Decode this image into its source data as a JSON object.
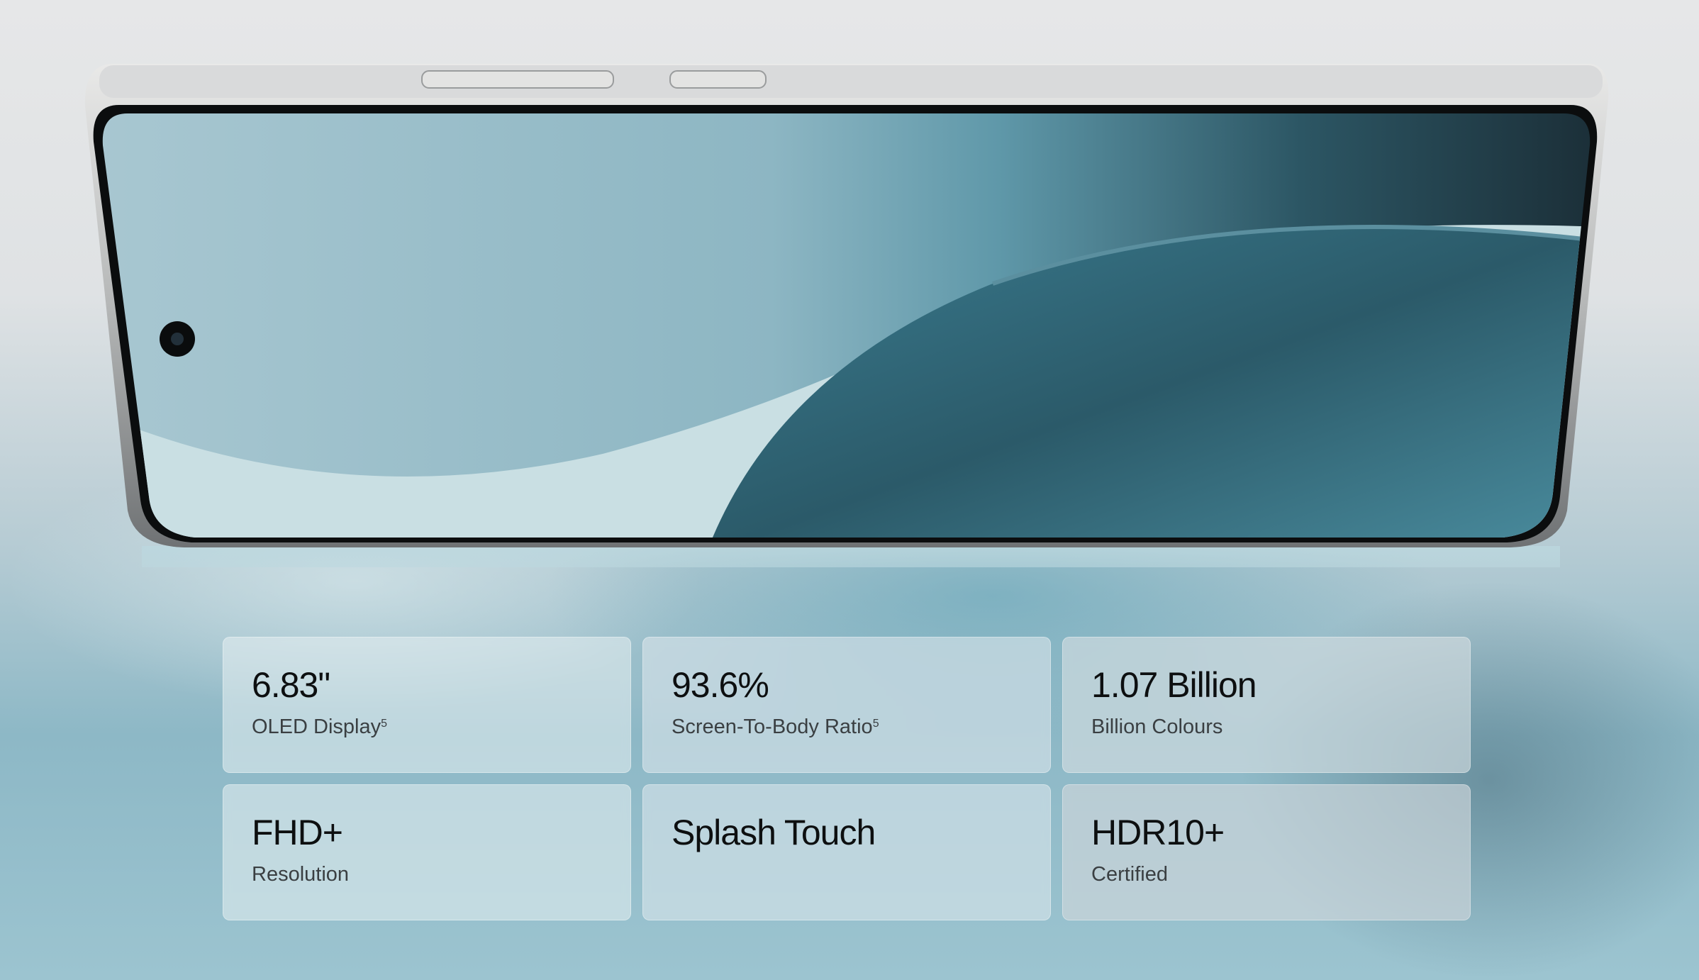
{
  "specs": [
    {
      "value": "6.83\"",
      "label": "OLED Display",
      "sup": "5"
    },
    {
      "value": "93.6%",
      "label": "Screen-To-Body Ratio",
      "sup": "5"
    },
    {
      "value": "1.07 Billion",
      "label": "Billion Colours",
      "sup": ""
    },
    {
      "value": "FHD+",
      "label": "Resolution",
      "sup": ""
    },
    {
      "value": "Splash Touch",
      "label": "",
      "sup": ""
    },
    {
      "value": "HDR10+",
      "label": "Certified",
      "sup": ""
    }
  ],
  "colors": {
    "frame": "#b9bbbc",
    "screen_light": "#a9c8d2",
    "screen_dark": "#1f3a46",
    "text": "#0d0f10"
  }
}
